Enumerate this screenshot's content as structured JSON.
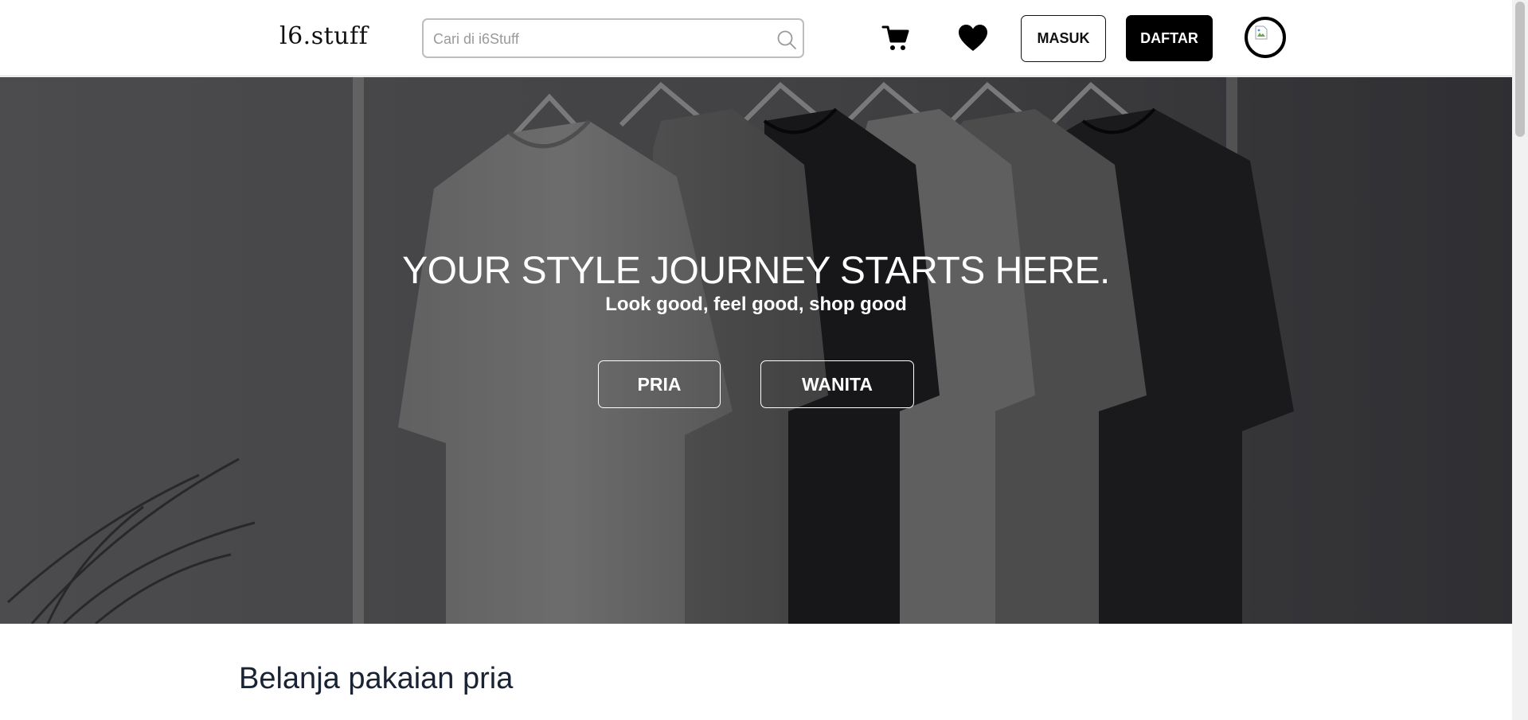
{
  "header": {
    "logo": "l6.stuff",
    "search": {
      "placeholder": "Cari di i6Stuff",
      "value": ""
    },
    "icons": [
      "search-icon",
      "cart-icon",
      "heart-icon"
    ],
    "login_label": "MASUK",
    "register_label": "DAFTAR"
  },
  "hero": {
    "title": "YOUR STYLE JOURNEY STARTS HERE.",
    "subtitle": "Look good, feel good, shop good",
    "buttons": {
      "men": "PRIA",
      "women": "WANITA"
    }
  },
  "section": {
    "title": "Belanja pakaian pria"
  },
  "colors": {
    "brand_black": "#000000",
    "text_dark": "#1a2333",
    "hero_overlay": "#3a3a3e",
    "border_grey": "#bdbdbd"
  }
}
